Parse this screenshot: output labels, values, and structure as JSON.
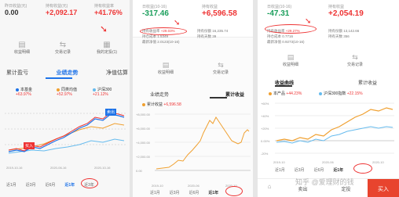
{
  "panel1": {
    "header": {
      "col1_label": "昨日收益(元)",
      "col1_value": "0.00",
      "col2_label": "持有收益(元)",
      "col2_value": "+2,092.17",
      "col3_label": "持有收益率",
      "col3_value": "+41.76%"
    },
    "actions": [
      "收益明细",
      "交易记录",
      "我的定投(1)"
    ],
    "tabs": [
      "累计盈亏",
      "业绩走势",
      "净值估算"
    ],
    "legend": [
      {
        "name": "本基金",
        "value": "+63.97%",
        "color": "#1e73e8"
      },
      {
        "name": "同类均值",
        "value": "+52.97%",
        "color": "#f0a030"
      },
      {
        "name": "沪深300",
        "value": "+21.12%",
        "color": "#66bbee"
      }
    ],
    "badge": "买入",
    "high_label": "卖出",
    "x_ticks": [
      "2019-10-16",
      "2020-06-16",
      "2020-10-16"
    ],
    "ranges": [
      "近1月",
      "近3月",
      "近6月",
      "近1年",
      "近3年"
    ],
    "selected_range": "近1年"
  },
  "panel2": {
    "header": {
      "col1_label": "日收益(10-16)",
      "col1_value": "-317.46",
      "col2_label": "持有收益",
      "col2_value": "+6,596.58"
    },
    "stats": [
      {
        "label": "持有收益率",
        "value": "+29.03%"
      },
      {
        "label": "持有份额",
        "value": "16,235.74"
      },
      {
        "label": "持仓成本",
        "value": "1.5349"
      },
      {
        "label": "持有天数",
        "value": "39"
      },
      {
        "label": "最新净值",
        "value": "2.0123(10-16)"
      }
    ],
    "actions": [
      "收益明细",
      "交易记录"
    ],
    "tabs": [
      "业绩走势",
      "累计收益"
    ],
    "legend": [
      {
        "name": "累计收益",
        "value": "+6,596.58",
        "color": "#f0a030"
      }
    ],
    "y_ticks": [
      "+8,000.00",
      "+6,000.00",
      "+4,000.00",
      "+2,000.00",
      "0.00"
    ],
    "x_ticks": [
      "2019-10",
      "2020-06",
      "2020-10"
    ],
    "ranges": [
      "近1月",
      "近3月",
      "近6月",
      "近1年"
    ],
    "selected_range": "近1年"
  },
  "panel3": {
    "header": {
      "col1_label": "日收益(10-16)",
      "col1_value": "-47.31",
      "col2_label": "持有收益",
      "col2_value": "+2,054.19"
    },
    "stats": [
      {
        "label": "持有收益率",
        "value": "+29.27%"
      },
      {
        "label": "持有份额",
        "value": "13,142.66"
      },
      {
        "label": "持仓成本",
        "value": "0.7716"
      },
      {
        "label": "持有天数",
        "value": "356"
      },
      {
        "label": "最新净值",
        "value": "0.9273(10-16)"
      }
    ],
    "actions": [
      "收益明细",
      "交易记录"
    ],
    "tabs": [
      "收益曲线",
      "累计收益"
    ],
    "legend": [
      {
        "name": "本产品",
        "value": "+44.23%",
        "color": "#f0a030"
      },
      {
        "name": "沪深300指数",
        "value": "+22.15%",
        "color": "#66bbee"
      }
    ],
    "y_ticks": [
      "+60%",
      "+40%",
      "+20%",
      "0.00%",
      "-20%"
    ],
    "x_ticks": [
      "2019-10",
      "2020-06",
      "2020-10"
    ],
    "ranges": [
      "近1月",
      "近3月",
      "近6月",
      "近1年"
    ],
    "selected_range": "近1年",
    "bottom": {
      "labels": [
        "卖出",
        "定投",
        "买入"
      ],
      "buy_color": "#e8442e"
    },
    "watermark": "知乎 @爱理财的钱"
  }
}
